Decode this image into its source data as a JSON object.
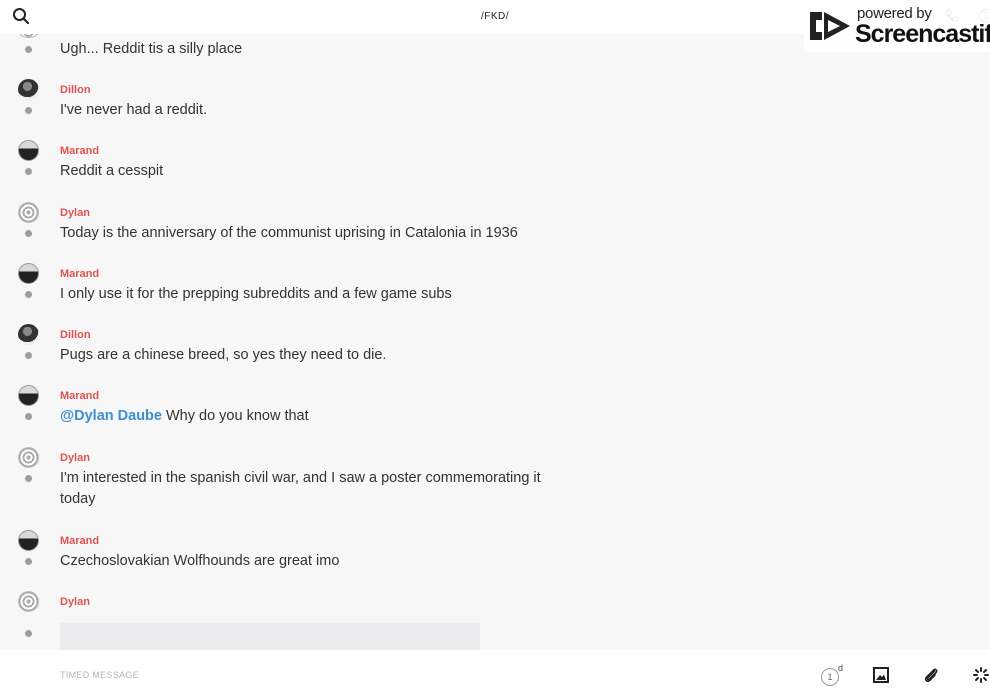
{
  "header": {
    "channel_title": "/FKD/"
  },
  "watermark": {
    "powered_by": "powered by",
    "brand": "Screencastify"
  },
  "messages": [
    {
      "author": "",
      "text": "Ugh... Reddit tis a silly place",
      "avatar": "dylan"
    },
    {
      "author": "Dillon",
      "text": "I've never had a reddit.",
      "avatar": "dillon"
    },
    {
      "author": "Marand",
      "text": "Reddit a cesspit",
      "avatar": "marand"
    },
    {
      "author": "Dylan",
      "text": "Today is the anniversary of the communist uprising in Catalonia in 1936",
      "avatar": "dylan"
    },
    {
      "author": "Marand",
      "text": "I only use it for the prepping subreddits and a few game subs",
      "avatar": "marand"
    },
    {
      "author": "Dillon",
      "text": "Pugs are a chinese breed, so yes they need to die.",
      "avatar": "dillon"
    },
    {
      "author": "Marand",
      "mention": "@Dylan Daube",
      "text": " Why do you know that",
      "avatar": "marand"
    },
    {
      "author": "Dylan",
      "text": "I'm interested in the spanish civil war, and I saw a poster commemorating it today",
      "avatar": "dylan"
    },
    {
      "author": "Marand",
      "text": "Czechoslovakian Wolfhounds are great imo",
      "avatar": "marand"
    },
    {
      "author": "Dylan",
      "text": "",
      "avatar": "dylan"
    }
  ],
  "composer": {
    "placeholder": "TIMED MESSAGE",
    "timer_value": "1",
    "timer_unit": "d"
  },
  "icons": {
    "search": "search-icon",
    "phone": "phone-icon",
    "info": "info-icon",
    "image": "image-icon",
    "attach": "paperclip-icon",
    "more": "loading-spinner-icon"
  },
  "colors": {
    "author": "#e0524f",
    "mention": "#3d8fd1",
    "background": "#f7f7f8"
  }
}
